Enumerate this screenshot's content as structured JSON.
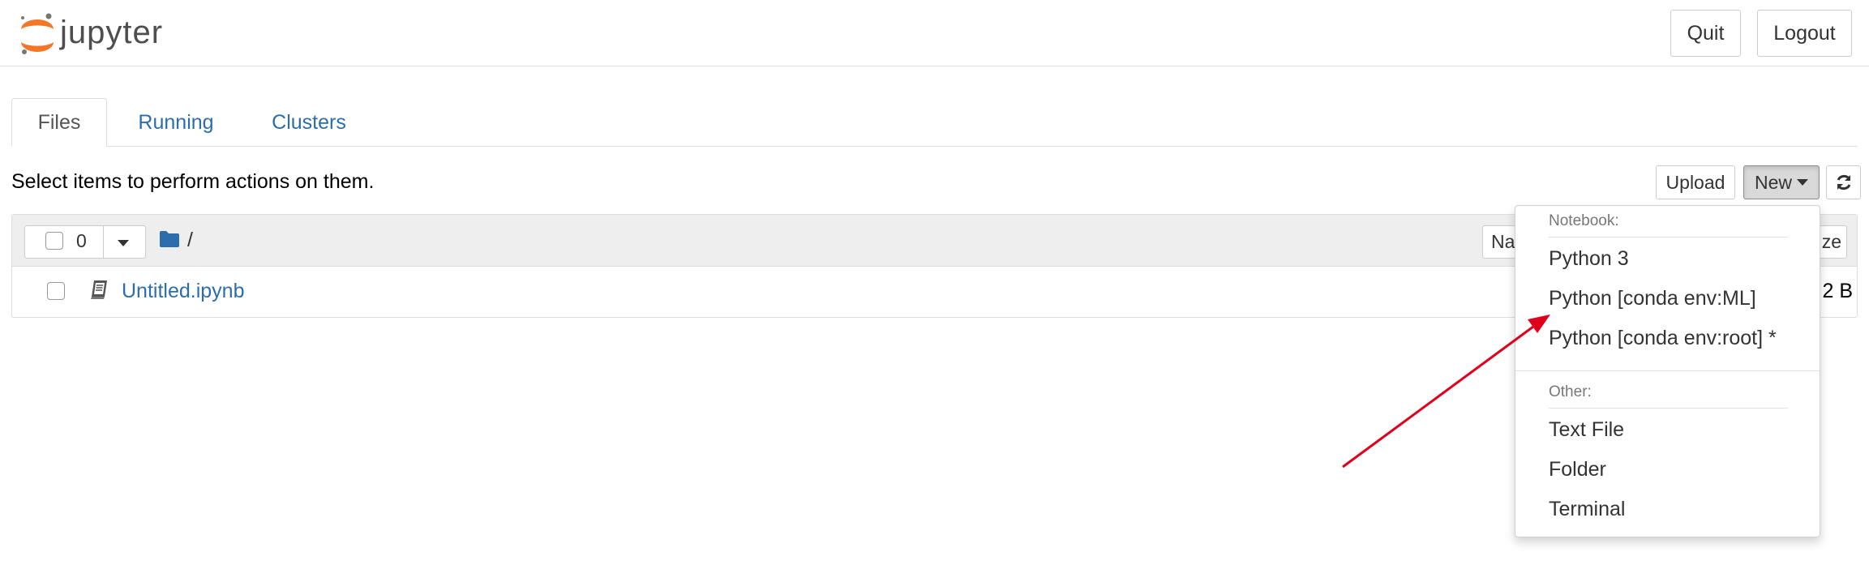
{
  "header": {
    "logo_text": "jupyter",
    "quit_label": "Quit",
    "logout_label": "Logout"
  },
  "tabs": [
    {
      "label": "Files",
      "active": true
    },
    {
      "label": "Running",
      "active": false
    },
    {
      "label": "Clusters",
      "active": false
    }
  ],
  "toolbar": {
    "message": "Select items to perform actions on them.",
    "upload_label": "Upload",
    "new_label": "New",
    "refresh_icon": "refresh-icon"
  },
  "file_list": {
    "selected_count": "0",
    "breadcrumb_root": "/",
    "name_column_label": "Na",
    "size_column_label": "ze",
    "files": [
      {
        "name": "Untitled.ipynb",
        "icon": "notebook-icon",
        "size": "2 B"
      }
    ]
  },
  "new_menu": {
    "notebook_header": "Notebook:",
    "notebook_items": [
      "Python 3",
      "Python [conda env:ML]",
      "Python [conda env:root] *"
    ],
    "other_header": "Other:",
    "other_items": [
      "Text File",
      "Folder",
      "Terminal"
    ]
  },
  "colors": {
    "link": "#2c6dad",
    "logo_orange": "#f37726",
    "annotation_arrow": "#e0001b"
  }
}
